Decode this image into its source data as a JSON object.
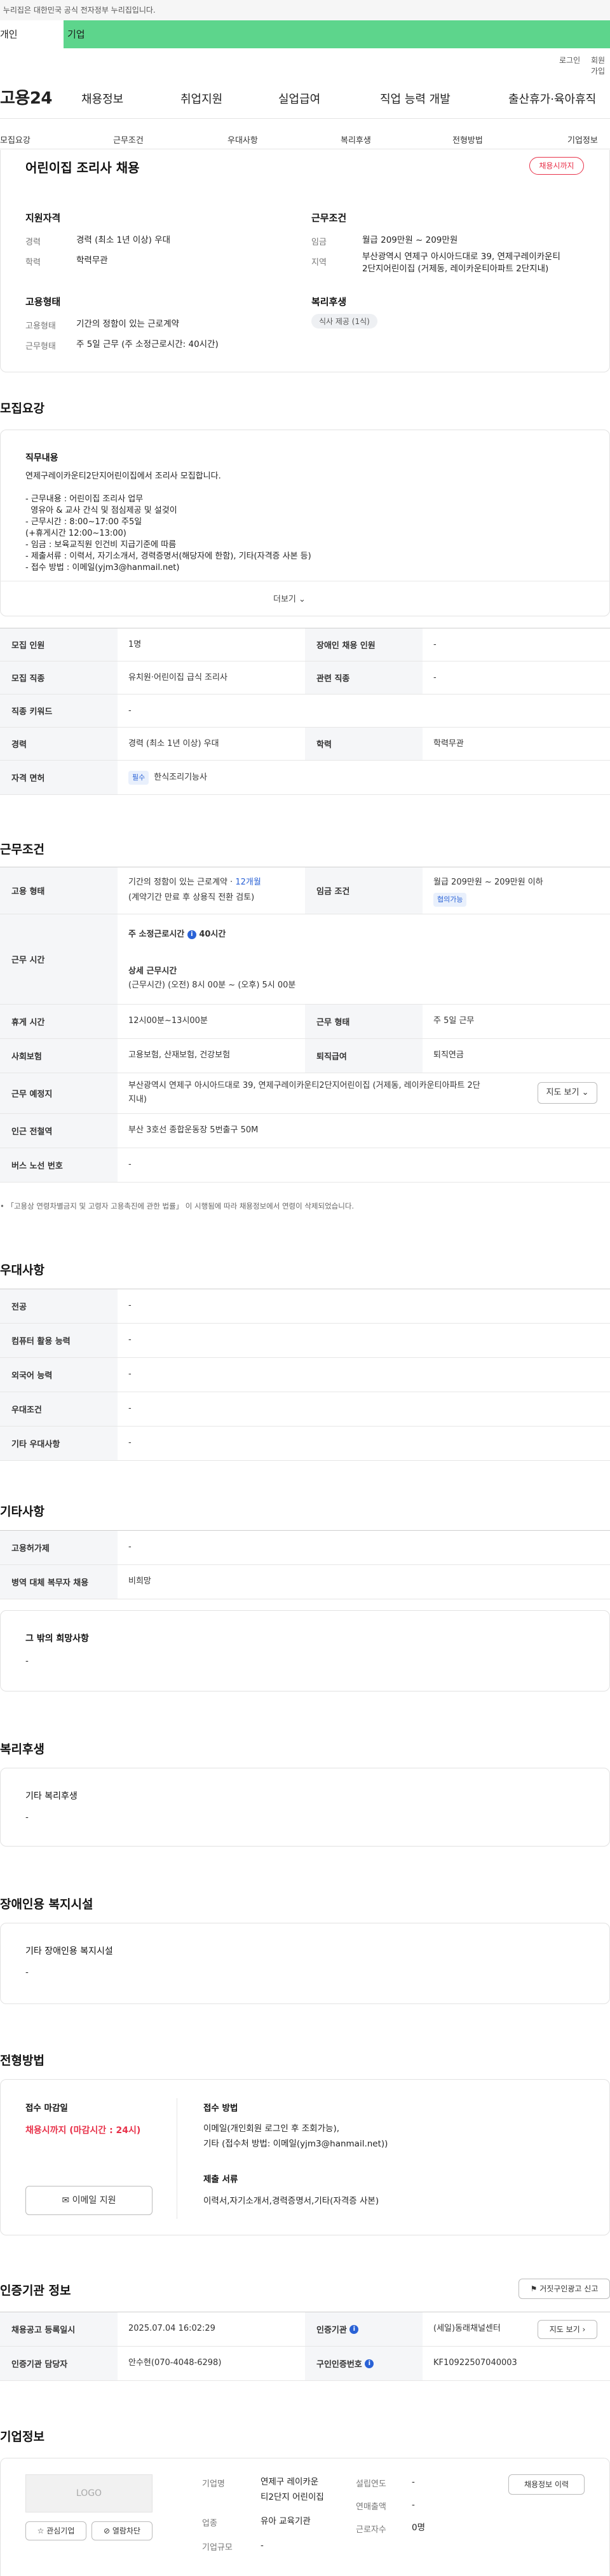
{
  "gov_banner": "이 누리집은 대한민국 공식 전자정부 누리집입니다.",
  "member_tabs": {
    "individual": "개인",
    "business": "기업"
  },
  "util_links": {
    "login": "로그인",
    "signup": "회원가입"
  },
  "brand": "고용24",
  "gnb": [
    "채용정보",
    "취업지원",
    "실업급여",
    "직업 능력 개발",
    "출산휴가·육아휴직"
  ],
  "snb": [
    "모집요강",
    "근무조건",
    "우대사항",
    "복리후생",
    "전형방법",
    "기업정보"
  ],
  "summary": {
    "title": "어린이집 조리사 채용",
    "status_badge": "채용시까지",
    "qual_title": "지원자격",
    "career_label": "경력",
    "career_value": "경력 (최소 1년 이상) 우대",
    "edu_label": "학력",
    "edu_value": "학력무관",
    "cond_title": "근무조건",
    "wage_label": "임금",
    "wage_value": "월급 209만원 ~ 209만원",
    "area_label": "지역",
    "area_value_1": "부산광역시 연제구 아시아드대로 39, 연제구레이카운티",
    "area_value_2": "2단지어린이집 (거제동, 레이카운티아파트 2단지내)",
    "emp_title": "고용형태",
    "emptype_label": "고용형태",
    "emptype_value": "기간의 정함이 있는 근로계약",
    "worktype_label": "근무형태",
    "worktype_value": "주 5일 근무 (주 소정근로시간: 40시간)",
    "welfare_title": "복리후생",
    "welfare_tag": "식사 제공 (1식)"
  },
  "recruit": {
    "section_title": "모집요강",
    "duty_title": "직무내용",
    "duty_lines": [
      "연제구레이카운티2단지어린이집에서 조리사 모집합니다.",
      "",
      "- 근무내용 : 어린이집 조리사 업무",
      "  영유아 & 교사 간식 및 점심제공 및 설겆이",
      "- 근무시간 : 8:00~17:00 주5일",
      "(+휴게시간 12:00~13:00)",
      "- 임금 : 보육교직원 인건비 지급기준에 따름",
      "- 제출서류 : 이력서, 자기소개서, 경력증명서(해당자에 한함), 기타(자격증 사본 등)",
      "- 접수 방법 : 이메일(yjm3@hanmail.net)"
    ],
    "more_label": "더보기",
    "table": {
      "headcount_label": "모집 인원",
      "headcount_value": "1명",
      "disabled_label": "장애인 채용 인원",
      "disabled_value": "-",
      "job_label": "모집 직종",
      "job_value": "유치원·어린이집 급식 조리사",
      "related_label": "관련 직종",
      "related_value": "-",
      "keyword_label": "직종 키워드",
      "keyword_value": "-",
      "career_label": "경력",
      "career_value": "경력 (최소 1년 이상) 우대",
      "edu_label": "학력",
      "edu_value": "학력무관",
      "license_label": "자격 면허",
      "license_badge": "필수",
      "license_value": "한식조리기능사"
    }
  },
  "work": {
    "section_title": "근무조건",
    "emptype_label": "고용 형태",
    "emptype_value_1": "기간의 정함이 있는 근로계약 · ",
    "emptype_months": "12개월",
    "emptype_value_2": "(계약기간 만료 후 상용직 전환 검토)",
    "wage_label": "임금 조건",
    "wage_value": "월급 209만원 ~ 209만원 이하",
    "wage_badge": "협의가능",
    "hours_label": "근무 시간",
    "hours_weekly_label": "주 소정근로시간",
    "hours_weekly_value": "40시간",
    "hours_detail_label": "상세 근무시간",
    "hours_detail_value": "(근무시간) (오전) 8시 00분 ~ (오후) 5시 00분",
    "break_label": "휴게 시간",
    "break_value": "12시00분~13시00분",
    "worktype_label": "근무 형태",
    "worktype_value": "주 5일 근무",
    "insurance_label": "사회보험",
    "insurance_value": "고용보험, 산재보험, 건강보험",
    "severance_label": "퇴직급여",
    "severance_value": "퇴직연금",
    "place_label": "근무 예정지",
    "place_value_1": "부산광역시 연제구 아시아드대로 39, 연제구레이카운티2단지어린이집 (거제동, 레이카운티아파트 2단",
    "place_value_2": "지내)",
    "map_button": "지도 보기",
    "subway_label": "인근 전철역",
    "subway_value": "부산 3호선 종합운동장 5번출구 50M",
    "bus_label": "버스 노선 번호",
    "bus_value": "-",
    "notice": "「고용상 연령차별금지 및 고령자 고용촉진에 관한 법률」 이 시행됨에 따라 채용정보에서 연령이 삭제되었습니다."
  },
  "preference": {
    "section_title": "우대사항",
    "rows": [
      {
        "label": "전공",
        "value": "-"
      },
      {
        "label": "컴퓨터 활용 능력",
        "value": "-"
      },
      {
        "label": "외국어 능력",
        "value": "-"
      },
      {
        "label": "우대조건",
        "value": "-"
      },
      {
        "label": "기타 우대사항",
        "value": "-"
      }
    ]
  },
  "etc": {
    "section_title": "기타사항",
    "rows": [
      {
        "label": "고용허가제",
        "value": "-"
      },
      {
        "label": "병역 대체 복무자 채용",
        "value": "비희망"
      }
    ],
    "other_title": "그 밖의 희망사항",
    "other_value": "-"
  },
  "welfare": {
    "section_title": "복리후생",
    "card_title": "기타 복리후생",
    "card_value": "-"
  },
  "disability": {
    "section_title": "장애인용 복지시설",
    "card_title": "기타 장애인용 복지시설",
    "card_value": "-"
  },
  "process": {
    "section_title": "전형방법",
    "deadline_label": "접수 마감일",
    "deadline_value": "채용시까지 (마감시간 : 24시)",
    "email_button": "이메일 지원",
    "method_label": "접수 방법",
    "method_value_1": "이메일(개인회원 로그인 후 조회가능),",
    "method_value_2": "기타 (접수처 방법: 이메일(yjm3@hanmail.net))",
    "docs_label": "제출 서류",
    "docs_value": "이력서,자기소개서,경력증명서,기타(자격증 사본)"
  },
  "agency": {
    "section_title": "인증기관 정보",
    "report_button": "거짓구인광고 신고",
    "regdate_label": "채용공고 등록일시",
    "regdate_value": "2025.07.04 16:02:29",
    "agency_label": "인증기관",
    "agency_value": "(세일)동래채널센터",
    "view_button": "지도 보기",
    "manager_label": "인증기관 담당자",
    "manager_value": "안수현(070-4048-6298)",
    "reqno_label": "구인인증번호",
    "reqno_value": "KF10922507040003"
  },
  "company": {
    "section_title": "기업정보",
    "logo_text": "LOGO",
    "fav_button": "관심기업",
    "block_button": "열람차단",
    "name_label": "기업명",
    "name_value_1": "연제구 레이카운",
    "name_value_2": "티2단지 어린이집",
    "founded_label": "설립연도",
    "founded_value": "-",
    "sales_label": "연매출액",
    "sales_value": "-",
    "industry_label": "업종",
    "industry_value": "유아 교육기관",
    "employees_label": "근로자수",
    "employees_value": "0명",
    "size_label": "기업규모",
    "size_value": "-",
    "jobs_button": "채용정보 이력"
  }
}
